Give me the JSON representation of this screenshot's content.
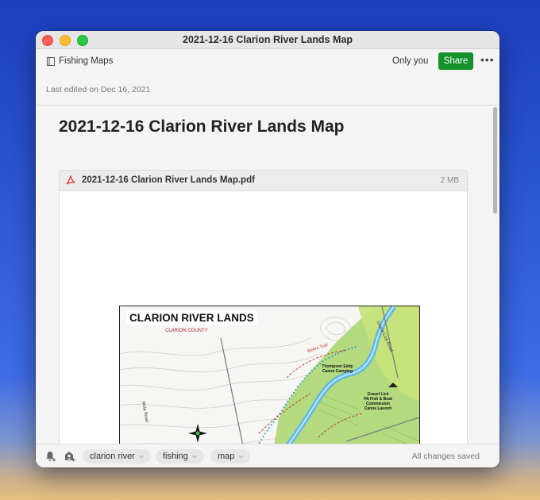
{
  "window": {
    "title": "2021-12-16 Clarion River Lands Map"
  },
  "toolbar": {
    "notebook_label": "Fishing Maps",
    "share_status": "Only you",
    "share_label": "Share",
    "more_label": "•••"
  },
  "meta": {
    "last_edited": "Last edited on Dec 16, 2021"
  },
  "note": {
    "title": "2021-12-16 Clarion River Lands Map"
  },
  "attachment": {
    "filename": "2021-12-16 Clarion River Lands Map.pdf",
    "size": "2 MB",
    "icon": "pdf-icon"
  },
  "map": {
    "title": "CLARION RIVER LANDS",
    "county": "CLARION COUNTY",
    "label_thompson": "Thompson Eddy\nCanoe Camping",
    "label_gravel": "Gravel Lick\nPA Fish & Boat\nCommission\nCanoe Launch",
    "road_gravel_lick": "Gravel Lick Road",
    "road_mola": "Mola Road",
    "trail_beers": "Beers Trail"
  },
  "footer": {
    "reminder_icon": "bell-plus-icon",
    "share_icon": "person-plus-icon",
    "tags": [
      "clarion river",
      "fishing",
      "map"
    ],
    "status": "All changes saved"
  },
  "colors": {
    "share_button": "#14912a",
    "river": "#5fb8e6",
    "map_green": "#a8d56b"
  }
}
